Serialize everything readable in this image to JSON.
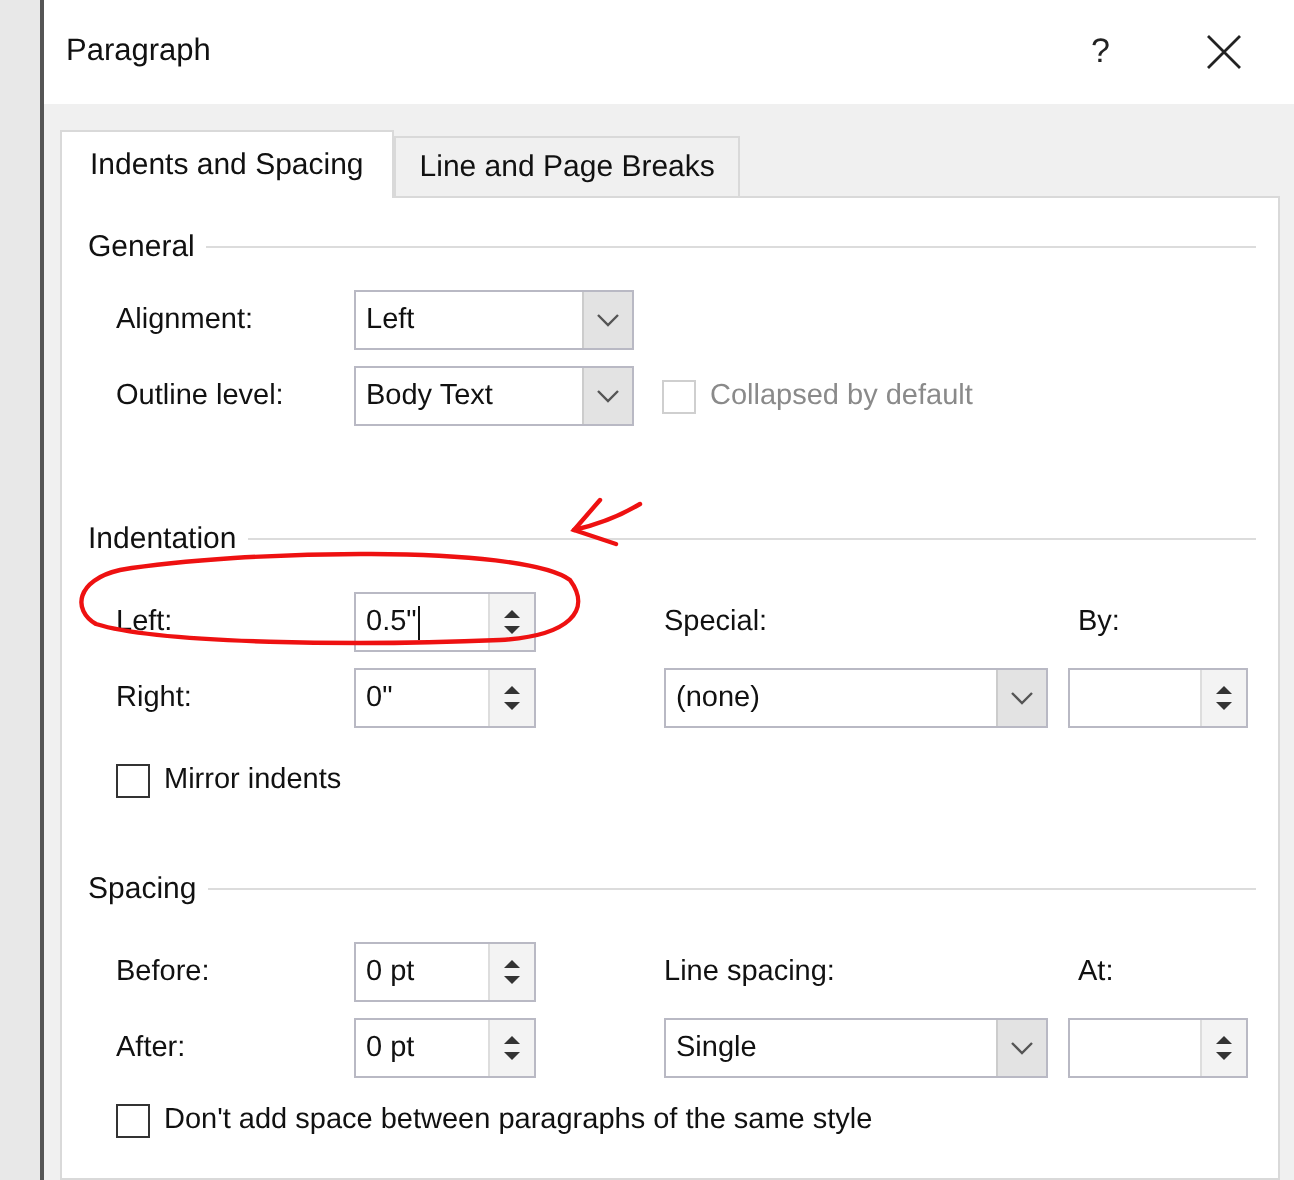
{
  "window": {
    "title": "Paragraph",
    "help": "?"
  },
  "tabs": [
    {
      "label": "Indents and Spacing",
      "selected": true
    },
    {
      "label": "Line and Page Breaks",
      "selected": false
    }
  ],
  "general": {
    "heading": "General",
    "alignment": {
      "label": "Alignment:",
      "value": "Left"
    },
    "outline_level": {
      "label": "Outline level:",
      "value": "Body Text"
    },
    "collapsed": {
      "label": "Collapsed by default",
      "checked": false,
      "disabled": true
    }
  },
  "indentation": {
    "heading": "Indentation",
    "left": {
      "label": "Left:",
      "value": "0.5\"",
      "focused": true
    },
    "right": {
      "label": "Right:",
      "value": "0\"",
      "focused": false
    },
    "special": {
      "label": "Special:",
      "value": "(none)"
    },
    "by": {
      "label": "By:"
    },
    "mirror": {
      "label": "Mirror indents",
      "checked": false,
      "disabled": false
    }
  },
  "spacing": {
    "heading": "Spacing",
    "before": {
      "label": "Before:",
      "value": "0 pt",
      "focused": false
    },
    "after": {
      "label": "After:",
      "value": "0 pt",
      "focused": false
    },
    "line_spacing": {
      "label": "Line spacing:",
      "value": "Single"
    },
    "at": {
      "label": "At:"
    },
    "dont_add": {
      "label": "Don't add space between paragraphs of the same style",
      "checked": false,
      "disabled": false
    }
  }
}
